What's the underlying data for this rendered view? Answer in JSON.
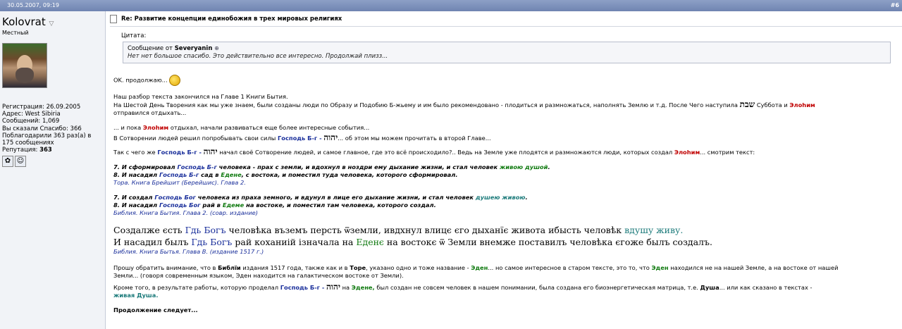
{
  "post": {
    "date": "30.05.2007, 09:19",
    "number": "#6"
  },
  "user": {
    "name": "Kolovrat",
    "title": "Местный",
    "registration": "Регистрация: 26.09.2005",
    "address": "Адрес: West Sibiria",
    "posts": "Сообщений: 1,069",
    "thanked": "Вы сказали Спасибо: 366",
    "thanks_received": "Поблагодарили 363 раз(а) в 175 сообщениях",
    "reputation_label": "Репутация:",
    "reputation_value": "363"
  },
  "title": "Re: Развитие концепции единобожия в трех мировых религиях",
  "quote": {
    "label": "Цитата:",
    "from_prefix": "Сообщение от",
    "author": "Severyanin",
    "text": "Нет нет большое спасибо. Это действительно все интересно. Продолжай плизз..."
  },
  "body": {
    "ok": "OK. продолжаю...",
    "l1": "Наш разбор текста закончился на Главе 1 Книги Бытия.",
    "l2a": "На Шестой День Творения как мы уже знаем, были созданы люди по Образу и Подобию Б-жьему и им было рекомендовано - плодиться и размножаться, наполнять Землю и т.д. После Чего наступила",
    "shabbat": "שבת",
    "l2b": "Суббота и",
    "elohim": "Элоhим",
    "l2c": "отправился отдыхать...",
    "l3a": "... и пока",
    "l3b": "отдыхал, начали развиваться еще более интересные события...",
    "l4a": "В Сотворении людей решил попробывать свои силы",
    "lord": "Господь Б-г -",
    "yhwh": "יהוה",
    "l4b": "... об этом мы можем прочитать в второй Главе...",
    "l5a": "Так с чего же",
    "l5b": "начал своё Сотворение людей, и самое главное, где это всё происходило?.. Ведь на Земле уже плодятся и размножаются люди, которых создал",
    "l5c": "... смотрим текст:",
    "v7a": "7. И сформировал",
    "v7lord": "Господь Б-г",
    "v7b": "человека - прах с земли, и вдохнул в ноздри ему дыхание жизни, и стал человек",
    "v7c": "живою душой",
    "v8a": "8. И насадил",
    "v8b": "сад в",
    "v8eden": "Едене",
    "v8c": ", с востока, и поместил туда человека, которого сформировал.",
    "src1": "Тора. Книга Брейшит (Берейшис). Глава 2.",
    "s7a": "7. И создал",
    "s7lord": "Господь Бог",
    "s7b": "человека из праха земного, и вдунул в лице его дыхание жизни, и стал человек",
    "s7c": "душею живою",
    "s8a": "8. И насадил",
    "s8b": "рай в",
    "s8eden": "Едеме",
    "s8c": "на востоке, и поместил там человека, которого создал.",
    "src2": "Библия. Книга Бытия. Глава 2. (совр. издание)",
    "c1a": "Создалже єсть",
    "c1lord": "Гдь Богъ",
    "c1b": "человѣка въземъ персть ѿземли, ивдхнул влицє єго дыханїє живота ибысть человѣк",
    "c1c": "вдушу живу.",
    "c2a": "И насадил былъ",
    "c2lord": "Гдь Богъ",
    "c2b": "рай коханиій ізначала на",
    "c2eden": "Еденє",
    "c2c": "на востокє ѿ Земли внемже поставилъ человѣка єгоже былъ создалъ.",
    "src3": "Библия. Книга Бытья. Глава В. (издание 1517 г.)",
    "p1a": "Прошу обратить внимание, что в",
    "p1bible": "Библїи",
    "p1b": "издания 1517 года, также как и в",
    "p1tora": "Торе",
    "p1c": ", указано одно и тоже название -",
    "p1eden": "Эден",
    "p1d": "... но самое интересное в старом тексте, это то, что",
    "p1eden2": "Эден",
    "p1e": "находился не на нашей Земле, а на востоке от нашей",
    "p1f": "Земли... (говоря современным языком, Эден находится на галактическом востоке от Земли).",
    "p2a": "Кроме того, в результате работы, которую проделал",
    "p2b": "на",
    "p2eden": "Эдене,",
    "p2c": "был создан не совсем человек в нашем понимании, была создана его биоэнергетическая матрица, т.е.",
    "p2soul": "Душа",
    "p2d": "... или как сказано в текстах -",
    "p2living": "живая Душа.",
    "cont": "Продолжение следует..."
  }
}
